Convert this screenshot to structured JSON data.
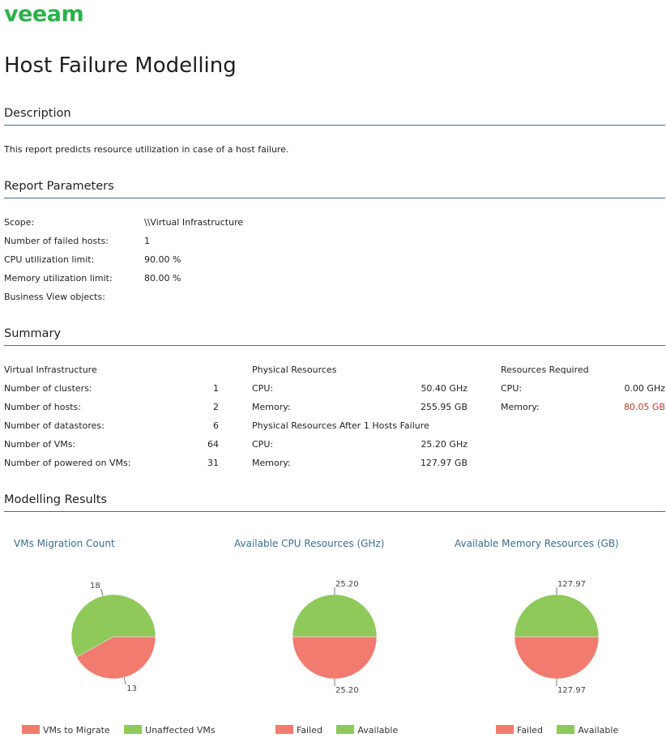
{
  "brand": {
    "logo_text": "veeam",
    "color": "#2ab24b"
  },
  "title": "Host Failure Modelling",
  "description": {
    "heading": "Description",
    "text": "This report predicts resource utilization in case of a host failure."
  },
  "parameters": {
    "heading": "Report Parameters",
    "rows": [
      {
        "label": "Scope:",
        "value": "\\\\Virtual Infrastructure"
      },
      {
        "label": "Number of failed hosts:",
        "value": "1"
      },
      {
        "label": "CPU utilization limit:",
        "value": "90.00 %"
      },
      {
        "label": "Memory utilization limit:",
        "value": "80.00 %"
      },
      {
        "label": "Business View objects:",
        "value": ""
      }
    ]
  },
  "summary": {
    "heading": "Summary",
    "virtual": {
      "title": "Virtual Infrastructure",
      "rows": [
        {
          "label": "Number of clusters:",
          "value": "1"
        },
        {
          "label": "Number of hosts:",
          "value": "2"
        },
        {
          "label": "Number of datastores:",
          "value": "6"
        },
        {
          "label": "Number of VMs:",
          "value": "64"
        },
        {
          "label": "Number of powered on VMs:",
          "value": "31"
        }
      ]
    },
    "physical": {
      "title": "Physical Resources",
      "rows": [
        {
          "label": "CPU:",
          "value": "50.40 GHz"
        },
        {
          "label": "Memory:",
          "value": "255.95 GB"
        }
      ],
      "after_title": "Physical Resources After 1 Hosts Failure",
      "after_rows": [
        {
          "label": "CPU:",
          "value": "25.20 GHz"
        },
        {
          "label": "Memory:",
          "value": "127.97 GB"
        }
      ]
    },
    "required": {
      "title": "Resources Required",
      "rows": [
        {
          "label": "CPU:",
          "value": "0.00 GHz",
          "highlight": false
        },
        {
          "label": "Memory:",
          "value": "80.05 GB",
          "highlight": true
        }
      ]
    }
  },
  "results": {
    "heading": "Modelling Results"
  },
  "chart_data": [
    {
      "type": "pie",
      "title": "VMs Migration Count",
      "categories": [
        "VMs to Migrate",
        "Unaffected VMs"
      ],
      "values": [
        13,
        18
      ],
      "labels": [
        "13",
        "18"
      ],
      "colors": [
        "#f07b6e",
        "#8ec95a"
      ],
      "legend": "bottom"
    },
    {
      "type": "pie",
      "title": "Available CPU Resources (GHz)",
      "categories": [
        "Failed",
        "Available"
      ],
      "values": [
        25.2,
        25.2
      ],
      "labels": [
        "25.20",
        "25.20"
      ],
      "colors": [
        "#f07b6e",
        "#8ec95a"
      ],
      "legend": "bottom"
    },
    {
      "type": "pie",
      "title": "Available Memory Resources (GB)",
      "categories": [
        "Failed",
        "Available"
      ],
      "values": [
        127.97,
        127.97
      ],
      "labels": [
        "127.97",
        "127.97"
      ],
      "colors": [
        "#f07b6e",
        "#8ec95a"
      ],
      "legend": "bottom"
    }
  ]
}
